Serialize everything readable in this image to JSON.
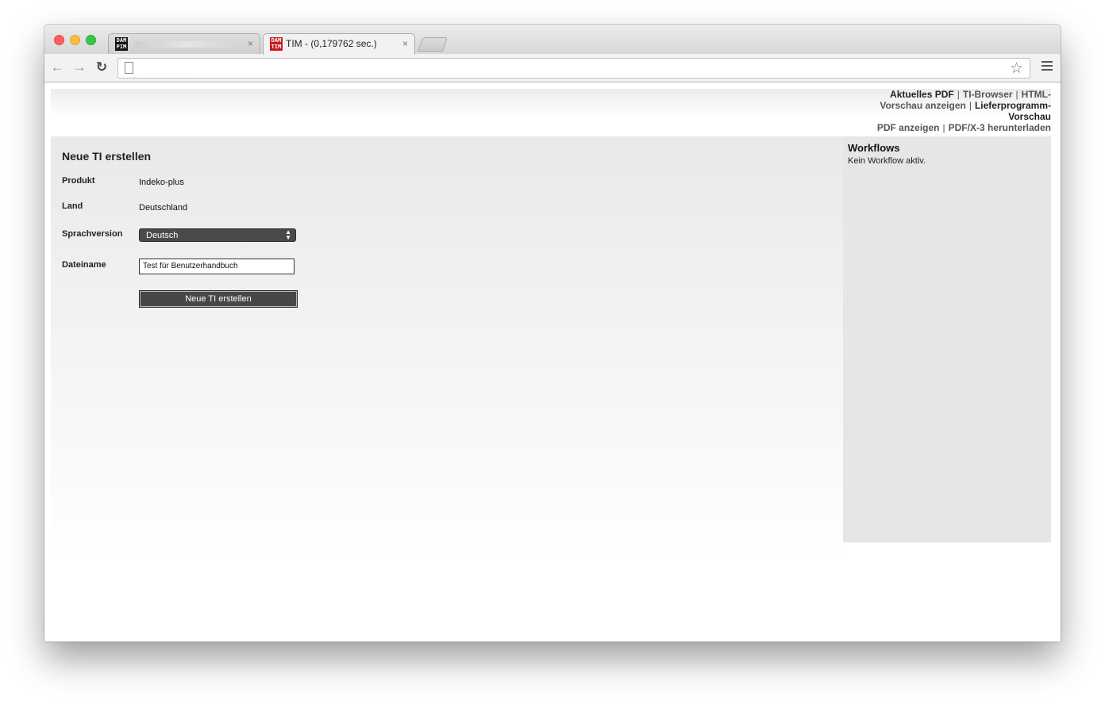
{
  "browser": {
    "tabs": [
      {
        "title": "",
        "favicon_text": "DAM PIM",
        "active": false
      },
      {
        "title": "TIM - (0,179762 sec.)",
        "favicon_text": "DAM TIM",
        "active": true
      }
    ],
    "tab_close_glyph": "×",
    "url": ""
  },
  "topnav": {
    "aktuelles_pdf": "Aktuelles PDF",
    "ti_browser": "TI-Browser",
    "html_vorschau": "HTML-Vorschau anzeigen",
    "lieferprogramm_vorschau": "Lieferprogramm-Vorschau",
    "pdf_anzeigen": "PDF anzeigen",
    "pdfx3_herunterladen": "PDF/X-3 herunterladen",
    "separator": "|"
  },
  "form": {
    "title": "Neue TI erstellen",
    "produkt_label": "Produkt",
    "produkt_value": "Indeko-plus",
    "land_label": "Land",
    "land_value": "Deutschland",
    "sprachversion_label": "Sprachversion",
    "sprachversion_value": "Deutsch",
    "dateiname_label": "Dateiname",
    "dateiname_value": "Test für Benutzerhandbuch",
    "submit_label": "Neue TI erstellen"
  },
  "sidebar": {
    "title": "Workflows",
    "text": "Kein Workflow aktiv."
  },
  "icons": {
    "back": "arrow-left-icon",
    "forward": "arrow-right-icon",
    "reload": "reload-icon",
    "page": "page-icon",
    "star": "star-icon",
    "menu": "hamburger-menu-icon"
  }
}
